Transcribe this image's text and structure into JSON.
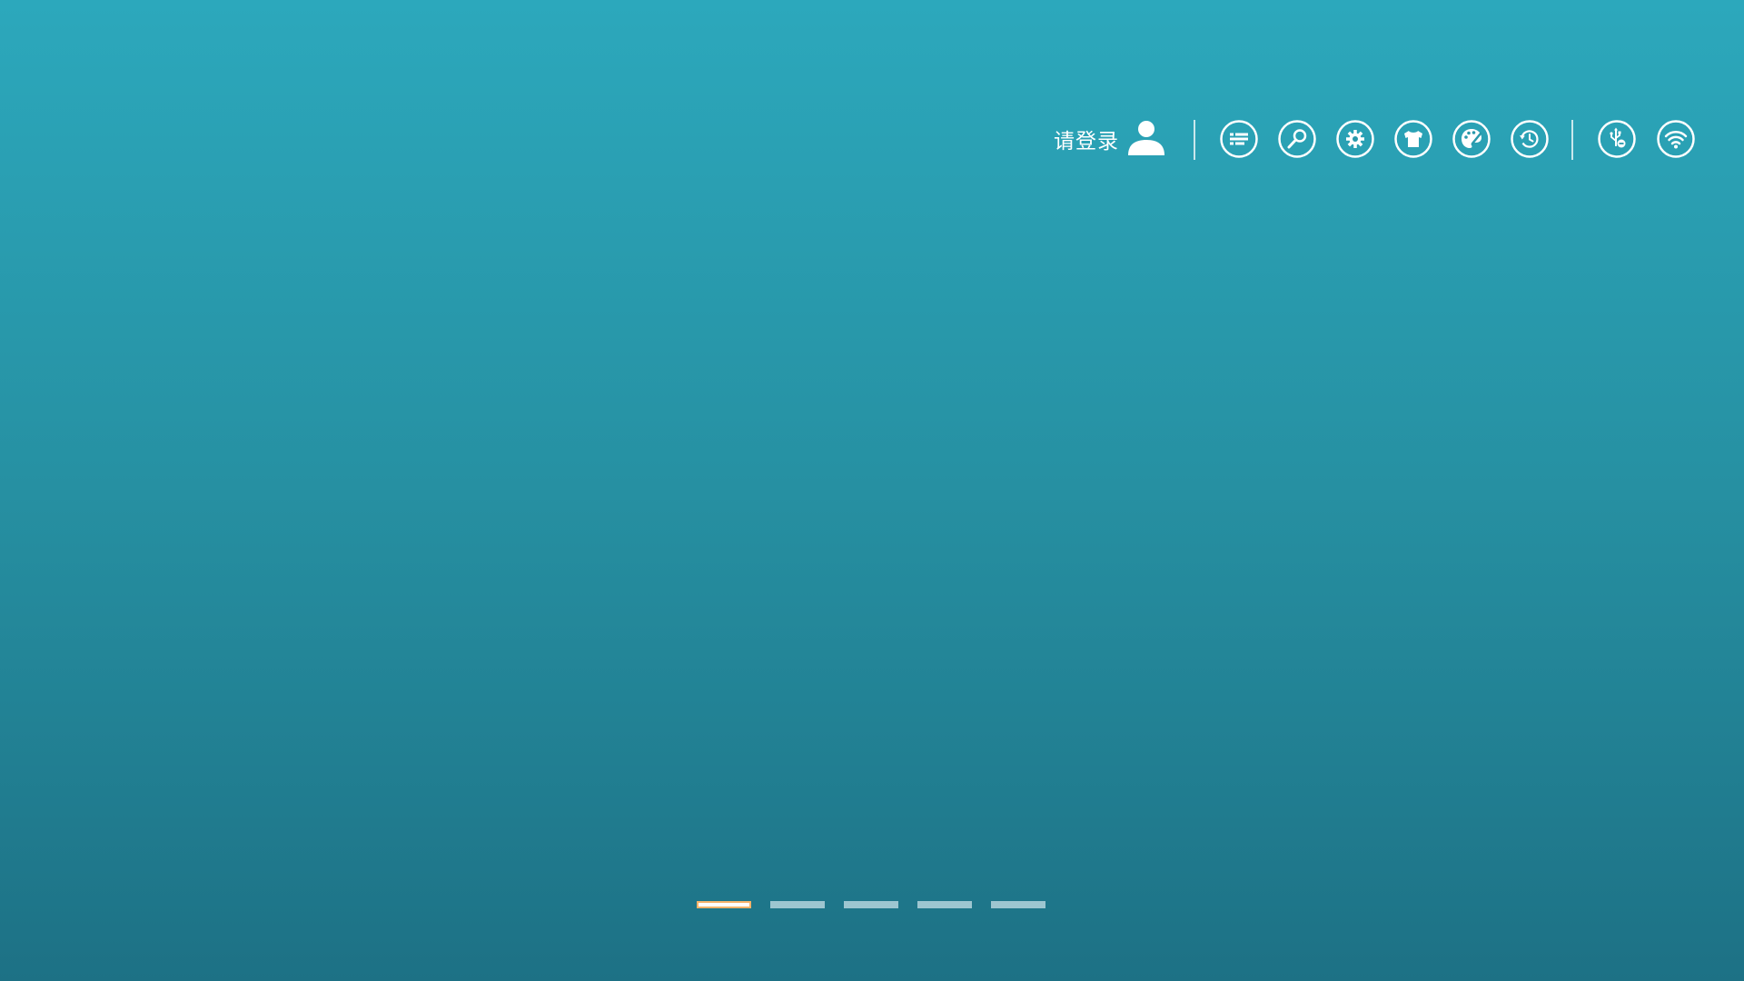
{
  "header": {
    "login_label": "请登录",
    "avatar_icon": "user-avatar-icon",
    "system_icons": [
      "list-icon",
      "search-icon",
      "settings-icon",
      "skin-shirt-icon",
      "theme-palette-icon",
      "history-clock-icon"
    ],
    "status_icons": [
      "usb-disconnected-icon",
      "wifi-icon"
    ]
  },
  "pager": {
    "page_count": 5,
    "active_index": 0,
    "active_color": "#f5b36a"
  },
  "colors": {
    "background_top": "#2ca8bc",
    "background_bottom": "#1d7185",
    "icon_color": "#ffffff"
  }
}
